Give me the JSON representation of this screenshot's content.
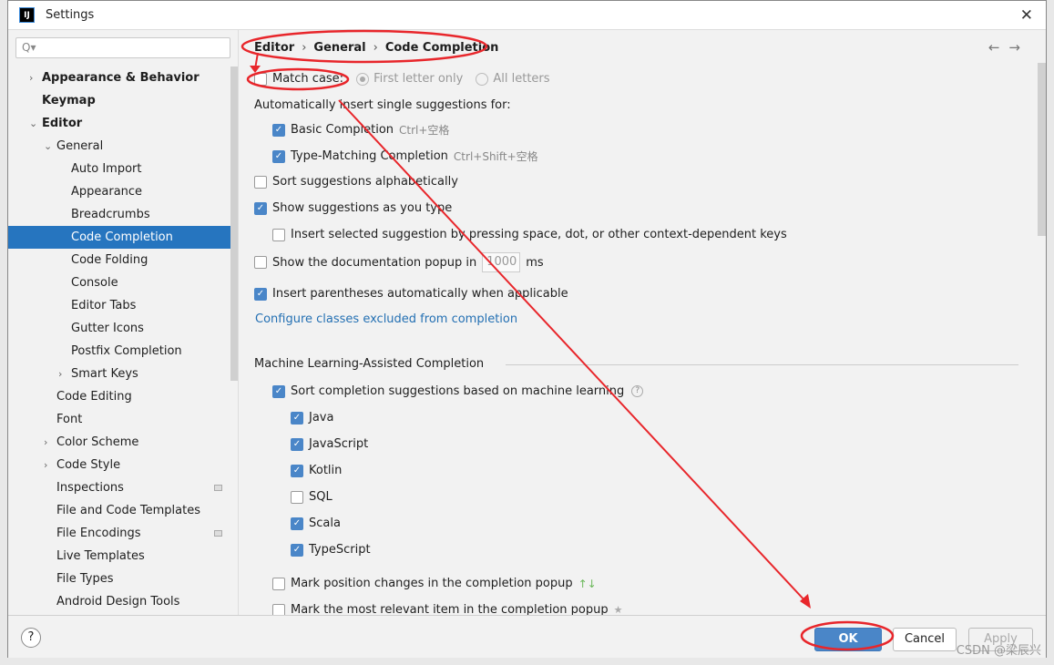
{
  "window": {
    "title": "Settings",
    "logo": "IJ",
    "close": "✕"
  },
  "search": {
    "placeholder": "Q▾"
  },
  "tree": [
    {
      "label": "Appearance & Behavior",
      "level": 0,
      "bold": true,
      "chevron": "›"
    },
    {
      "label": "Keymap",
      "level": 0,
      "bold": true
    },
    {
      "label": "Editor",
      "level": 0,
      "bold": true,
      "chevron": "⌄"
    },
    {
      "label": "General",
      "level": 1,
      "chevron": "⌄"
    },
    {
      "label": "Auto Import",
      "level": 2
    },
    {
      "label": "Appearance",
      "level": 2
    },
    {
      "label": "Breadcrumbs",
      "level": 2
    },
    {
      "label": "Code Completion",
      "level": 2,
      "selected": true
    },
    {
      "label": "Code Folding",
      "level": 2
    },
    {
      "label": "Console",
      "level": 2
    },
    {
      "label": "Editor Tabs",
      "level": 2
    },
    {
      "label": "Gutter Icons",
      "level": 2
    },
    {
      "label": "Postfix Completion",
      "level": 2
    },
    {
      "label": "Smart Keys",
      "level": 2,
      "chevron": "›"
    },
    {
      "label": "Code Editing",
      "level": 1
    },
    {
      "label": "Font",
      "level": 1
    },
    {
      "label": "Color Scheme",
      "level": 1,
      "chevron": "›"
    },
    {
      "label": "Code Style",
      "level": 1,
      "chevron": "›"
    },
    {
      "label": "Inspections",
      "level": 1,
      "badge": true
    },
    {
      "label": "File and Code Templates",
      "level": 1
    },
    {
      "label": "File Encodings",
      "level": 1,
      "badge": true
    },
    {
      "label": "Live Templates",
      "level": 1
    },
    {
      "label": "File Types",
      "level": 1
    },
    {
      "label": "Android Design Tools",
      "level": 1
    }
  ],
  "breadcrumb": [
    "Editor",
    "General",
    "Code Completion"
  ],
  "nav": {
    "back": "←",
    "forward": "→"
  },
  "match_case": {
    "label": "Match case:",
    "checked": false,
    "options": [
      "First letter only",
      "All letters"
    ],
    "selected": "First letter only"
  },
  "auto_insert_heading": "Automatically insert single suggestions for:",
  "options": [
    {
      "label": "Basic Completion",
      "shortcut": "Ctrl+空格",
      "checked": true,
      "indent": 1
    },
    {
      "label": "Type-Matching Completion",
      "shortcut": "Ctrl+Shift+空格",
      "checked": true,
      "indent": 1
    },
    {
      "label": "Sort suggestions alphabetically",
      "checked": false,
      "indent": 0
    },
    {
      "label": "Show suggestions as you type",
      "checked": true,
      "indent": 0
    },
    {
      "label": "Insert selected suggestion by pressing space, dot, or other context-dependent keys",
      "checked": false,
      "indent": 1
    }
  ],
  "doc_popup": {
    "label": "Show the documentation popup in",
    "value": "1000",
    "unit": "ms",
    "checked": false
  },
  "parens": {
    "label": "Insert parentheses automatically when applicable",
    "checked": true
  },
  "configure_link": "Configure classes excluded from completion",
  "ml": {
    "heading": "Machine Learning-Assisted Completion",
    "sort": {
      "label": "Sort completion suggestions based on machine learning",
      "checked": true,
      "help": "?"
    },
    "languages": [
      {
        "label": "Java",
        "checked": true
      },
      {
        "label": "JavaScript",
        "checked": true
      },
      {
        "label": "Kotlin",
        "checked": true
      },
      {
        "label": "SQL",
        "checked": false
      },
      {
        "label": "Scala",
        "checked": true
      },
      {
        "label": "TypeScript",
        "checked": true
      }
    ],
    "mark_changes": {
      "label": "Mark position changes in the completion popup",
      "checked": false,
      "icon": "↑↓"
    },
    "mark_relevant": {
      "label": "Mark the most relevant item in the completion popup",
      "checked": false,
      "icon": "★"
    }
  },
  "footer": {
    "help": "?",
    "ok": "OK",
    "cancel": "Cancel",
    "apply": "Apply"
  },
  "watermark": "CSDN @梁辰兴",
  "colors": {
    "accent": "#2675bf",
    "ok": "#4a86c8",
    "annotation": "#e8262b"
  }
}
